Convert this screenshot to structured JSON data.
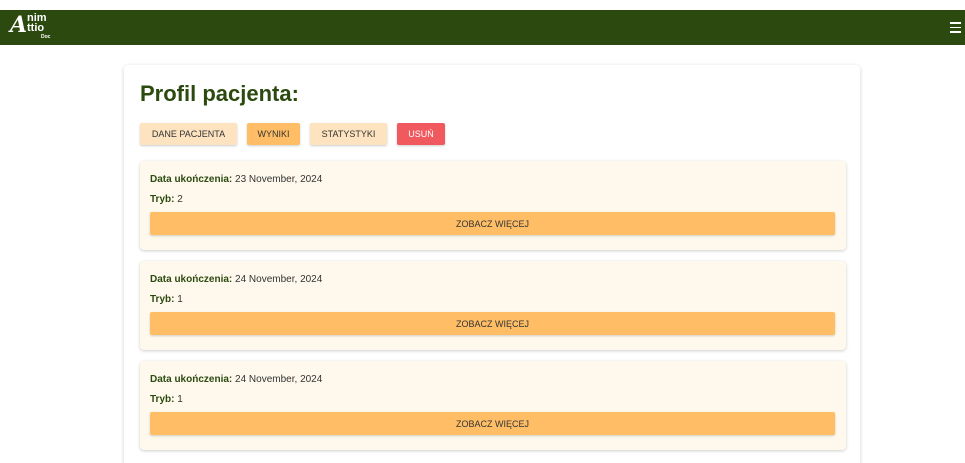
{
  "brand": {
    "logo_big": "A",
    "logo_line1": "nim",
    "logo_line2": "ttio",
    "logo_line3": "Doc"
  },
  "colors": {
    "navbar": "#2c4a0f",
    "tab_light": "#fde3bf",
    "tab_active": "#ffbe66",
    "danger": "#f05a5f",
    "card_bg": "#fef9ec"
  },
  "page_title": "Profil pacjenta:",
  "tabs": {
    "dane": "DANE PACJENTA",
    "wyniki": "WYNIKI",
    "statystyki": "STATYSTYKI",
    "usun": "USUŃ"
  },
  "results": [
    {
      "date_label": "Data ukończenia:",
      "date": " 23 November, 2024",
      "mode_label": "Tryb:",
      "mode": " 2",
      "button": "ZOBACZ WIĘCEJ"
    },
    {
      "date_label": "Data ukończenia:",
      "date": " 24 November, 2024",
      "mode_label": "Tryb:",
      "mode": " 1",
      "button": "ZOBACZ WIĘCEJ"
    },
    {
      "date_label": "Data ukończenia:",
      "date": " 24 November, 2024",
      "mode_label": "Tryb:",
      "mode": " 1",
      "button": "ZOBACZ WIĘCEJ"
    }
  ]
}
